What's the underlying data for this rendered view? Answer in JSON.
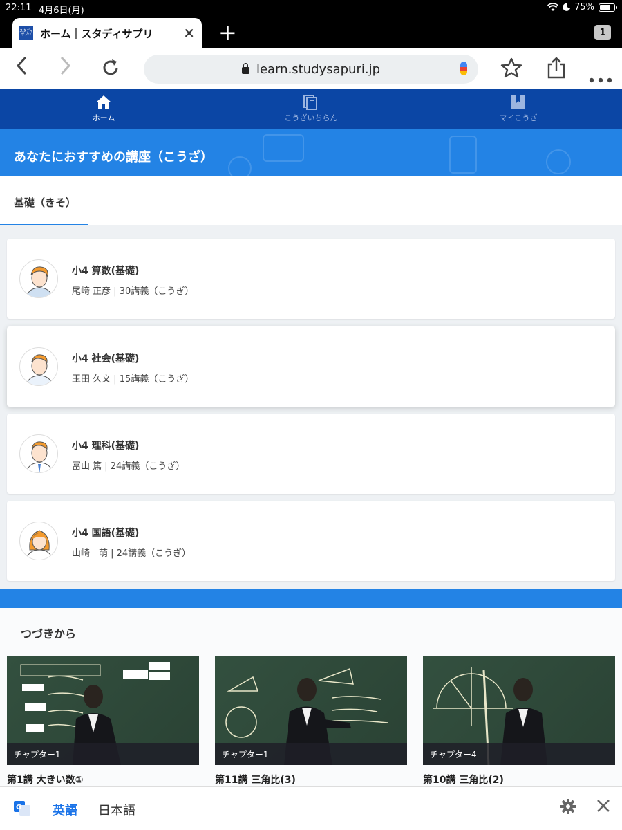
{
  "status": {
    "time": "22:11",
    "date": "4月6日(月)",
    "battery": "75%"
  },
  "browser": {
    "tab_title": "ホーム｜スタディサプリ",
    "favicon_text": "スタディ\nサプリ",
    "tab_count": "1",
    "url": "learn.studysapuri.jp"
  },
  "nav": {
    "home": "ホーム",
    "catalog": "こうざいちらん",
    "my": "マイこうざ"
  },
  "banner_title": "あなたにおすすめの講座（こうざ）",
  "tab_label": "基礎（きそ）",
  "courses": [
    {
      "title": "小4 算数(基礎)",
      "meta": "尾﨑 正彦 | 30講義（こうぎ）"
    },
    {
      "title": "小4 社会(基礎)",
      "meta": "玉田 久文 | 15講義（こうぎ）"
    },
    {
      "title": "小4 理科(基礎)",
      "meta": "冨山 篤 | 24講義（こうぎ）"
    },
    {
      "title": "小4 国語(基礎)",
      "meta": "山崎　萌 | 24講義（こうぎ）"
    }
  ],
  "continue": {
    "title": "つづきから",
    "videos": [
      {
        "chapter": "チャプター1",
        "title": "第1講 大きい数①"
      },
      {
        "chapter": "チャプター1",
        "title": "第11講 三角比(3)"
      },
      {
        "chapter": "チャプター4",
        "title": "第10講 三角比(2)"
      }
    ]
  },
  "translate": {
    "active_lang": "英語",
    "other_lang": "日本語"
  },
  "colors": {
    "nav_bg": "#0b46a5",
    "banner_bg": "#2383e5",
    "link_blue": "#1a73e8"
  }
}
